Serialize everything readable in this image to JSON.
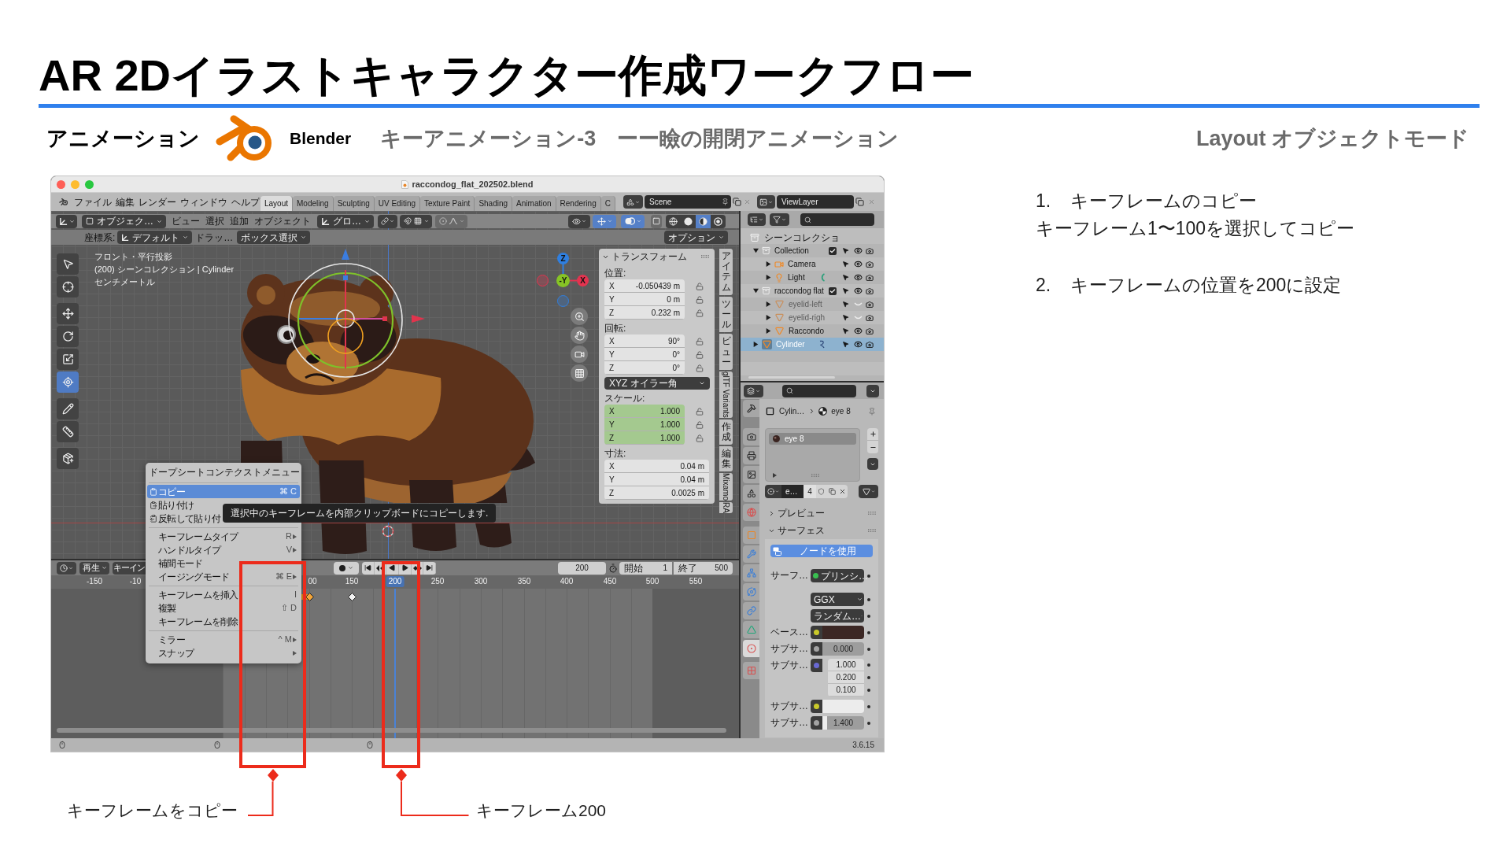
{
  "slide": {
    "title": "AR 2Dイラストキャラクター作成ワークフロー",
    "section": "アニメーション",
    "app_name": "Blender",
    "subtitle": "キーアニメーション-3　ーー瞼の開閉アニメーション",
    "mode": "Layout オブジェクトモード"
  },
  "steps": [
    {
      "number": "1.",
      "text": "キーフレームのコピー",
      "detail": "キーフレーム1〜100を選択してコピー"
    },
    {
      "number": "2.",
      "text": "キーフレームの位置を200に設定"
    }
  ],
  "callouts": [
    {
      "label": "キーフレームをコピー"
    },
    {
      "label": "キーフレーム200"
    }
  ],
  "blender": {
    "window": {
      "title": "raccondog_flat_202502.blend"
    },
    "menus": [
      "ファイル",
      "編集",
      "レンダー",
      "ウィンドウ",
      "ヘルプ"
    ],
    "workspaces": [
      {
        "label": "Layout",
        "selected": true
      },
      {
        "label": "Modeling",
        "selected": false
      },
      {
        "label": "Sculpting",
        "selected": false
      },
      {
        "label": "UV Editing",
        "selected": false
      },
      {
        "label": "Texture Paint",
        "selected": false
      },
      {
        "label": "Shading",
        "selected": false
      },
      {
        "label": "Animation",
        "selected": false
      },
      {
        "label": "Rendering",
        "selected": false
      },
      {
        "label": "C",
        "selected": false
      }
    ],
    "scene": "Scene",
    "view_layer": "ViewLayer",
    "viewport": {
      "mode": "オブジェク…",
      "menus": [
        "ビュー",
        "選択",
        "追加",
        "オブジェクト"
      ],
      "orientation": "グロ…",
      "toggles": [
        {
          "kind": "gizmo",
          "on": true
        },
        {
          "kind": "overlay",
          "on": true
        },
        {
          "kind": "xray",
          "on": false
        }
      ],
      "shading": [
        {
          "kind": "wireframe",
          "selected": false
        },
        {
          "kind": "solid",
          "selected": false
        },
        {
          "kind": "material",
          "selected": true
        },
        {
          "kind": "rendered",
          "selected": false
        }
      ],
      "tool_settings": {
        "label": "座標系:",
        "orientation": "デフォルト",
        "drag": "ドラッ…",
        "select_mode": "ボックス選択",
        "options": "オプション"
      },
      "tool_groups": [
        [
          {
            "kind": "select",
            "selected": false
          },
          {
            "kind": "cursor",
            "selected": false
          }
        ],
        [
          {
            "kind": "move",
            "selected": false
          },
          {
            "kind": "rotate",
            "selected": false
          },
          {
            "kind": "scale",
            "selected": false
          },
          {
            "kind": "transform",
            "selected": true
          }
        ],
        [
          {
            "kind": "annotate",
            "selected": false
          },
          {
            "kind": "measure",
            "selected": false
          }
        ],
        [
          {
            "kind": "add_cube",
            "selected": false
          }
        ]
      ],
      "info": [
        "フロント・平行投影",
        "(200) シーンコレクション | Cylinder",
        "センチメートル"
      ],
      "axes": [
        {
          "label": "Z",
          "color": "#2f7fe0"
        },
        {
          "label": "-Y",
          "color": "#86c425"
        },
        {
          "label": "X",
          "color": "#e3334f"
        }
      ],
      "sidebar": {
        "title": "トランスフォーム",
        "sections": [
          {
            "label": "位置:",
            "animated": false,
            "locks": true,
            "rows": [
              {
                "axis": "X",
                "value": "-0.050439 m"
              },
              {
                "axis": "Y",
                "value": "0 m"
              },
              {
                "axis": "Z",
                "value": "0.232 m"
              }
            ]
          },
          {
            "label": "回転:",
            "animated": false,
            "locks": true,
            "rows": [
              {
                "axis": "X",
                "value": "90°"
              },
              {
                "axis": "Y",
                "value": "0°"
              },
              {
                "axis": "Z",
                "value": "0°"
              }
            ],
            "mode": "XYZ オイラー角"
          },
          {
            "label": "スケール:",
            "animated": true,
            "locks": true,
            "rows": [
              {
                "axis": "X",
                "value": "1.000"
              },
              {
                "axis": "Y",
                "value": "1.000"
              },
              {
                "axis": "Z",
                "value": "1.000"
              }
            ]
          },
          {
            "label": "寸法:",
            "animated": false,
            "locks": false,
            "rows": [
              {
                "axis": "X",
                "value": "0.04 m"
              },
              {
                "axis": "Y",
                "value": "0.04 m"
              },
              {
                "axis": "Z",
                "value": "0.0025 m"
              }
            ]
          }
        ],
        "tabs": [
          {
            "label": "アイテム",
            "kind": "stacked"
          },
          {
            "label": "ツール",
            "kind": "stacked"
          },
          {
            "label": "ビュー",
            "kind": "stacked"
          },
          {
            "label": "glTF Variants",
            "kind": "rotated"
          },
          {
            "label": "作成",
            "kind": "stacked"
          },
          {
            "label": "編集",
            "kind": "stacked"
          },
          {
            "label": "Mixamo",
            "kind": "rotated"
          },
          {
            "label": "RA",
            "kind": "rotated"
          }
        ]
      }
    },
    "context_menu": {
      "title": "ドープシートコンテクストメニュー",
      "groups": [
        [
          {
            "label": "コピー",
            "kind": "copy",
            "shortcut": "⌘ C",
            "selected": true,
            "submenu": false
          },
          {
            "label": "貼り付け",
            "kind": "paste",
            "selected": false,
            "submenu": false
          },
          {
            "label": "反転して貼り付",
            "kind": "paste_flipped",
            "selected": false,
            "submenu": false
          }
        ],
        [
          {
            "label": "キーフレームタイプ",
            "kind": "text",
            "shortcut": "R",
            "selected": false,
            "submenu": true
          },
          {
            "label": "ハンドルタイプ",
            "kind": "text",
            "shortcut": "V",
            "selected": false,
            "submenu": true
          },
          {
            "label": "補間モード",
            "kind": "text",
            "selected": false,
            "submenu": false
          },
          {
            "label": "イージングモード",
            "kind": "text",
            "shortcut": "⌘ E",
            "selected": false,
            "submenu": true
          }
        ],
        [
          {
            "label": "キーフレームを挿入",
            "kind": "text",
            "shortcut": "I",
            "selected": false,
            "submenu": false
          },
          {
            "label": "複製",
            "kind": "text",
            "shortcut": "⇧ D",
            "selected": false,
            "submenu": false
          },
          {
            "label": "キーフレームを削除",
            "kind": "text",
            "selected": false,
            "submenu": false
          }
        ],
        [
          {
            "label": "ミラー",
            "kind": "text",
            "shortcut": "^ M",
            "selected": false,
            "submenu": true
          },
          {
            "label": "スナップ",
            "kind": "text",
            "selected": false,
            "submenu": true
          }
        ]
      ]
    },
    "tooltip": "選択中のキーフレームを内部クリップボードにコピーします.",
    "timeline": {
      "playback": "再生",
      "keying": "キーイン",
      "current_frame": "200",
      "start_label": "開始",
      "start": "1",
      "end_label": "終了",
      "end": "500",
      "ruler": [
        {
          "label": "-150",
          "selected": false
        },
        {
          "label": "-10",
          "selected": false
        },
        {
          "label": "00",
          "selected": false
        },
        {
          "label": "150",
          "selected": false
        },
        {
          "label": "200",
          "selected": true
        },
        {
          "label": "250",
          "selected": false
        },
        {
          "label": "300",
          "selected": false
        },
        {
          "label": "350",
          "selected": false
        },
        {
          "label": "400",
          "selected": false
        },
        {
          "label": "450",
          "selected": false
        },
        {
          "label": "500",
          "selected": false
        },
        {
          "label": "550",
          "selected": false
        }
      ],
      "keyframes": [
        {
          "selected": true
        },
        {
          "selected": false
        }
      ]
    },
    "outliner": {
      "root": {
        "label": "シーンコレクショ",
        "children": [
          {
            "label": "Collection",
            "kind": "collection",
            "expanded": true,
            "checked": true,
            "visible": true,
            "selected": false,
            "children": [
              {
                "label": "Camera",
                "kind": "camera",
                "expanded": false,
                "visible": true,
                "selected": false
              },
              {
                "label": "Light",
                "kind": "light",
                "expanded": false,
                "visible": true,
                "selected": false,
                "badge": {
                  "kind": "light"
                }
              }
            ]
          },
          {
            "label": "raccondog flat",
            "kind": "collection",
            "expanded": true,
            "checked": true,
            "visible": true,
            "selected": false,
            "children": [
              {
                "label": "eyelid-left",
                "kind": "mesh",
                "expanded": false,
                "visible": false,
                "selected": false
              },
              {
                "label": "eyelid-righ",
                "kind": "mesh",
                "expanded": false,
                "visible": false,
                "selected": false
              },
              {
                "label": "Raccondo",
                "kind": "mesh",
                "expanded": false,
                "visible": true,
                "selected": false
              }
            ]
          },
          {
            "label": "Cylinder",
            "kind": "mesh",
            "expanded": false,
            "visible": true,
            "selected": true,
            "badge": {
              "kind": "hook"
            }
          }
        ]
      }
    },
    "properties": {
      "tab_groups": [
        [
          {
            "kind": "tool",
            "selected": false
          }
        ],
        [
          {
            "kind": "render",
            "selected": false
          },
          {
            "kind": "output",
            "selected": false
          },
          {
            "kind": "view_layer",
            "selected": false
          },
          {
            "kind": "scene",
            "selected": false
          },
          {
            "kind": "world",
            "selected": false
          }
        ],
        [
          {
            "kind": "object",
            "selected": false
          },
          {
            "kind": "modifiers",
            "selected": false
          },
          {
            "kind": "particles",
            "selected": false
          },
          {
            "kind": "physics",
            "selected": false
          },
          {
            "kind": "constraints",
            "selected": false
          },
          {
            "kind": "data",
            "selected": false
          },
          {
            "kind": "material",
            "selected": true
          }
        ],
        [
          {
            "kind": "texture",
            "selected": false
          }
        ]
      ],
      "breadcrumb": [
        "Cylin…",
        "eye 8"
      ],
      "slots": [
        {
          "label": "eye 8",
          "selected": true
        }
      ],
      "material": {
        "name": "e…",
        "users": "4"
      },
      "panels": [
        {
          "label": "プレビュー",
          "expanded": false
        },
        {
          "label": "サーフェス",
          "expanded": true,
          "use_nodes": "ノードを使用",
          "inputs": [
            {
              "kind": "shader",
              "label": "サーフ…",
              "value": "プリンシ…"
            },
            {
              "kind": "menu",
              "value": "GGX"
            },
            {
              "kind": "menu",
              "value": "ランダム…"
            },
            {
              "kind": "color",
              "label": "ベース…",
              "color": "#3b2724"
            },
            {
              "kind": "float",
              "label": "サブサ…",
              "value": "0.000"
            },
            {
              "kind": "vector",
              "label": "サブサ…",
              "values": [
                "1.000",
                "0.200",
                "0.100"
              ]
            },
            {
              "kind": "color",
              "label": "サブサ…",
              "color": "#ececec"
            },
            {
              "kind": "float",
              "label": "サブサ…",
              "value": "1.400",
              "level": 0.12
            }
          ]
        }
      ]
    },
    "version": "3.6.15"
  }
}
